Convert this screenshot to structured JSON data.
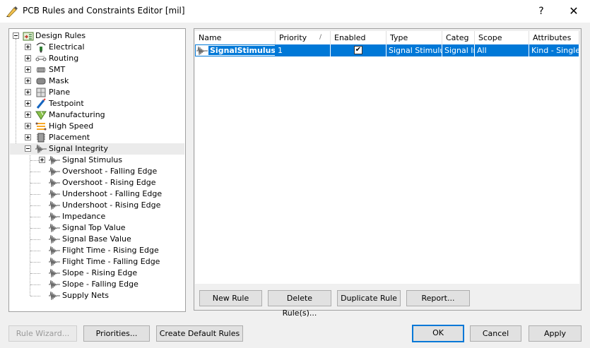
{
  "window": {
    "title": "PCB Rules and Constraints Editor [mil]",
    "help_glyph": "?",
    "close_glyph": "✕"
  },
  "tree": {
    "root": "Design Rules",
    "categories": [
      {
        "label": "Electrical",
        "icon": "electrical-icon"
      },
      {
        "label": "Routing",
        "icon": "routing-icon"
      },
      {
        "label": "SMT",
        "icon": "smt-icon"
      },
      {
        "label": "Mask",
        "icon": "mask-icon"
      },
      {
        "label": "Plane",
        "icon": "plane-icon"
      },
      {
        "label": "Testpoint",
        "icon": "testpoint-icon"
      },
      {
        "label": "Manufacturing",
        "icon": "manufacturing-icon"
      },
      {
        "label": "High Speed",
        "icon": "high-speed-icon"
      },
      {
        "label": "Placement",
        "icon": "placement-icon"
      },
      {
        "label": "Signal Integrity",
        "icon": "signal-integrity-icon"
      }
    ],
    "signal_integrity_children": [
      "Signal Stimulus",
      "Overshoot - Falling Edge",
      "Overshoot - Rising Edge",
      "Undershoot - Falling Edge",
      "Undershoot - Rising Edge",
      "Impedance",
      "Signal Top Value",
      "Signal Base Value",
      "Flight Time - Rising Edge",
      "Flight Time - Falling Edge",
      "Slope - Rising Edge",
      "Slope - Falling Edge",
      "Supply Nets"
    ]
  },
  "grid": {
    "columns": [
      "Name",
      "Priority",
      "Enabled",
      "Type",
      "Categ",
      "Scope",
      "Attributes"
    ],
    "sort_glyph": "/",
    "rows": [
      {
        "name": "SignalStimulus",
        "priority": "1",
        "enabled_mark": "✔",
        "type": "Signal Stimulu",
        "category": "Signal Ir",
        "scope": "All",
        "attributes": "Kind - Single"
      }
    ]
  },
  "rule_buttons": {
    "new_rule": "New Rule",
    "delete_rule": "Delete Rule(s)...",
    "duplicate_rule": "Duplicate Rule",
    "report": "Report..."
  },
  "footer": {
    "rule_wizard": "Rule Wizard...",
    "priorities": "Priorities...",
    "create_default_rules": "Create Default Rules",
    "ok": "OK",
    "cancel": "Cancel",
    "apply": "Apply"
  },
  "colors": {
    "selection": "#0078d7",
    "tree_highlight": "#ebebeb",
    "dialog_background": "#f0f0f0"
  }
}
